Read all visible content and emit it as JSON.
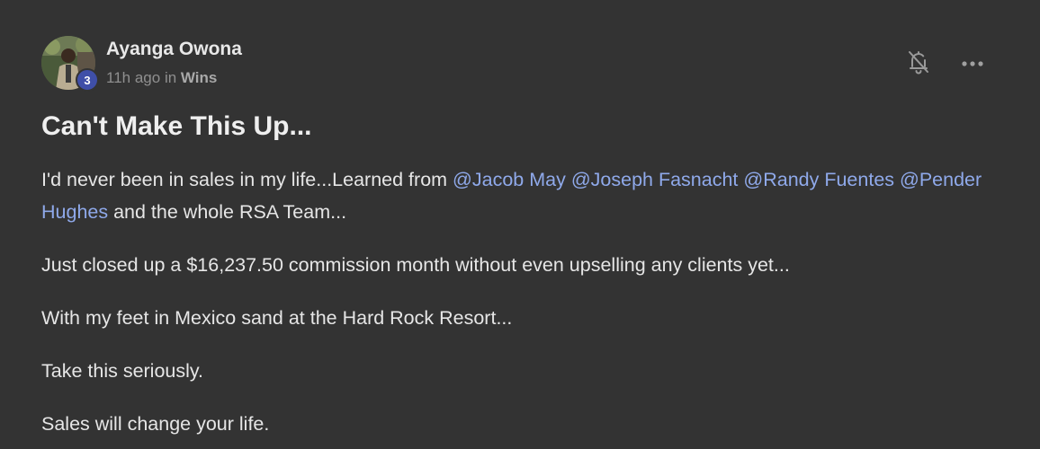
{
  "author": {
    "name": "Ayanga Owona",
    "level": "3",
    "time_ago": "11h ago",
    "in_label": "in",
    "category": "Wins"
  },
  "post": {
    "title": "Can't Make This Up...",
    "paragraph1": {
      "prefix": "I'd never been in sales in my life...Learned from ",
      "mentions": [
        "@Jacob May",
        "@Joseph Fasnacht",
        "@Randy Fuentes",
        "@Pender Hughes"
      ],
      "suffix": " and the whole RSA Team..."
    },
    "paragraph2": "Just closed up a $16,237.50 commission month without even upselling any clients yet...",
    "paragraph3": "With my feet in Mexico sand at the Hard Rock Resort...",
    "paragraph4": "Take this seriously.",
    "paragraph5": "Sales will change your life."
  },
  "icons": {
    "bell": "bell-off-icon",
    "more": "more-horizontal-icon"
  },
  "colors": {
    "background": "#333333",
    "mention": "#8fa9ea",
    "level_badge": "#3f4fa8"
  }
}
